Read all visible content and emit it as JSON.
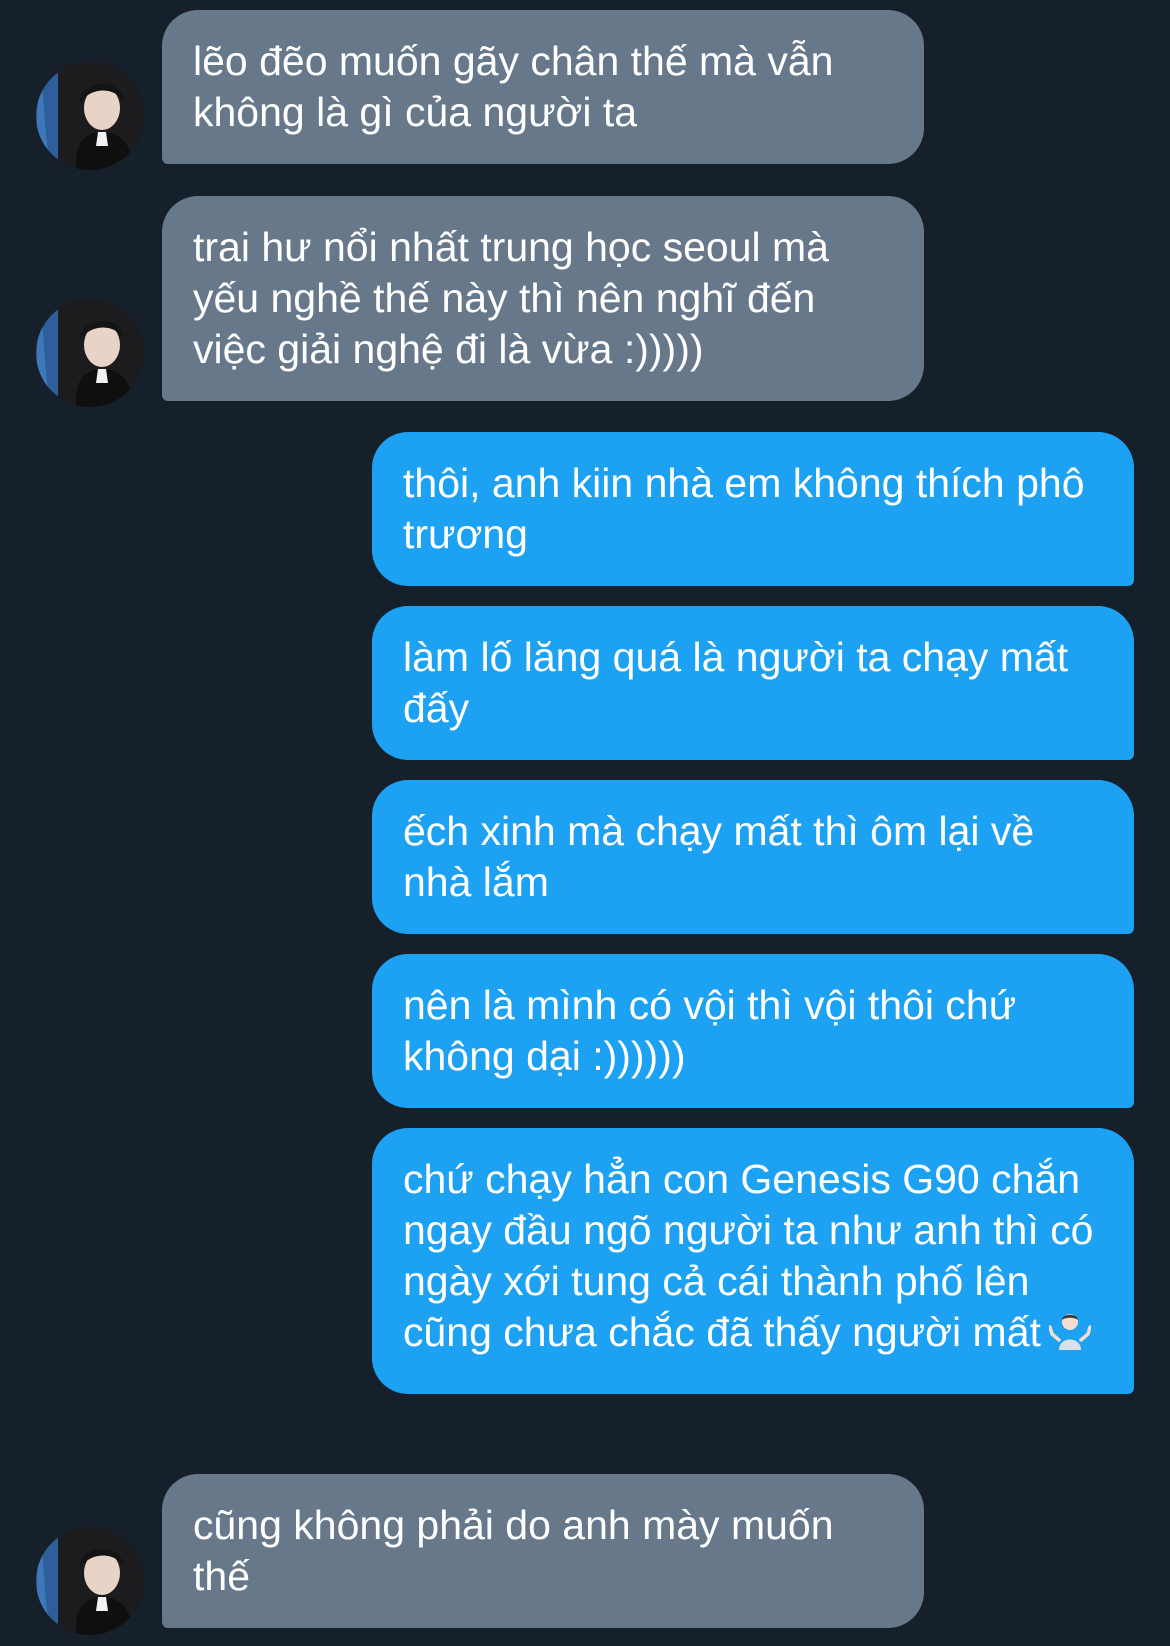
{
  "conversation": {
    "messages": [
      {
        "direction": "incoming",
        "text": "lẽo đẽo muốn gãy chân thế mà vẫn không là gì của người ta"
      },
      {
        "direction": "incoming",
        "text": "trai hư nổi nhất trung học seoul mà yếu nghề thế này thì nên nghĩ đến việc giải nghệ đi là vừa :)))))"
      },
      {
        "direction": "outgoing",
        "text": "thôi, anh kiin nhà em không thích phô trương"
      },
      {
        "direction": "outgoing",
        "text": "làm lố lăng quá là người ta chạy mất đấy"
      },
      {
        "direction": "outgoing",
        "text": "ếch xinh mà chạy mất thì ôm lại về nhà lắm"
      },
      {
        "direction": "outgoing",
        "text": "nên là mình có vội thì vội thôi chứ không dại :))))))"
      },
      {
        "direction": "outgoing",
        "text": "chứ chạy hẳn con Genesis G90 chắn ngay đầu ngõ người ta như anh thì có ngày xới tung cả cái thành phố lên cũng chưa chắc đã thấy người mất",
        "emoji": "person-shrugging-icon"
      },
      {
        "direction": "incoming",
        "text": "cũng không phải do anh mày muốn thế"
      }
    ]
  },
  "colors": {
    "background": "#15202b",
    "incoming_bubble": "#66788a",
    "outgoing_bubble": "#1da1f2",
    "text": "#ffffff"
  }
}
